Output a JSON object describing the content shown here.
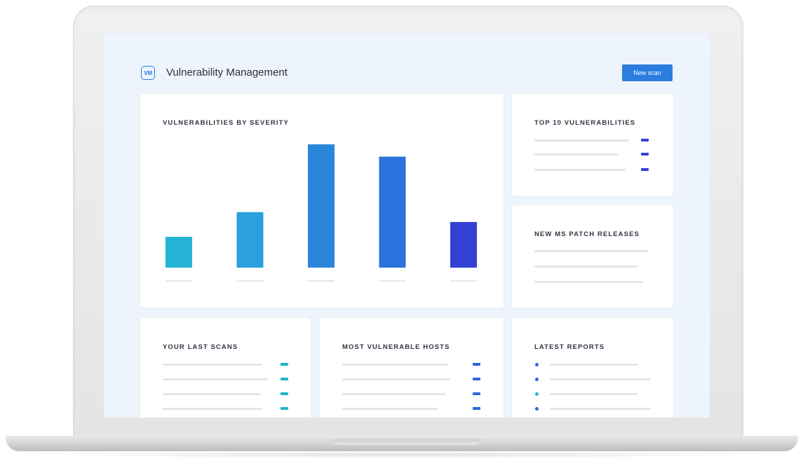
{
  "app": {
    "logo_text": "VM",
    "title": "Vulnerability Management",
    "new_scan_label": "New scan"
  },
  "colors": {
    "accent": "#2b7de0",
    "bar_series": [
      "#25b4d6",
      "#2aa0dc",
      "#2a86da",
      "#2b72dc",
      "#3341d4"
    ],
    "marker_cyan": "#1fb5c8",
    "marker_blue": "#2b68db",
    "marker_indigo": "#3a3fd6"
  },
  "icons": {
    "logo": "vm-logo-icon"
  },
  "cards": {
    "severity": {
      "title": "VULNERABILITIES BY SEVERITY"
    },
    "top10": {
      "title": "TOP 10 VULNERABILITIES",
      "row_count": 3
    },
    "ms_patch": {
      "title": "NEW MS PATCH RELEASES",
      "row_count": 3
    },
    "last_scans": {
      "title": "YOUR LAST SCANS",
      "row_count": 4
    },
    "hosts": {
      "title": "MOST VULNERABLE HOSTS",
      "row_count": 4
    },
    "reports": {
      "title": "LATEST REPORTS",
      "row_count": 4
    }
  },
  "chart_data": {
    "type": "bar",
    "title": "VULNERABILITIES BY SEVERITY",
    "categories": [
      "",
      "",
      "",
      "",
      ""
    ],
    "values": [
      25,
      45,
      100,
      90,
      37
    ],
    "ylim": [
      0,
      100
    ],
    "grid": false,
    "legend": "none"
  }
}
